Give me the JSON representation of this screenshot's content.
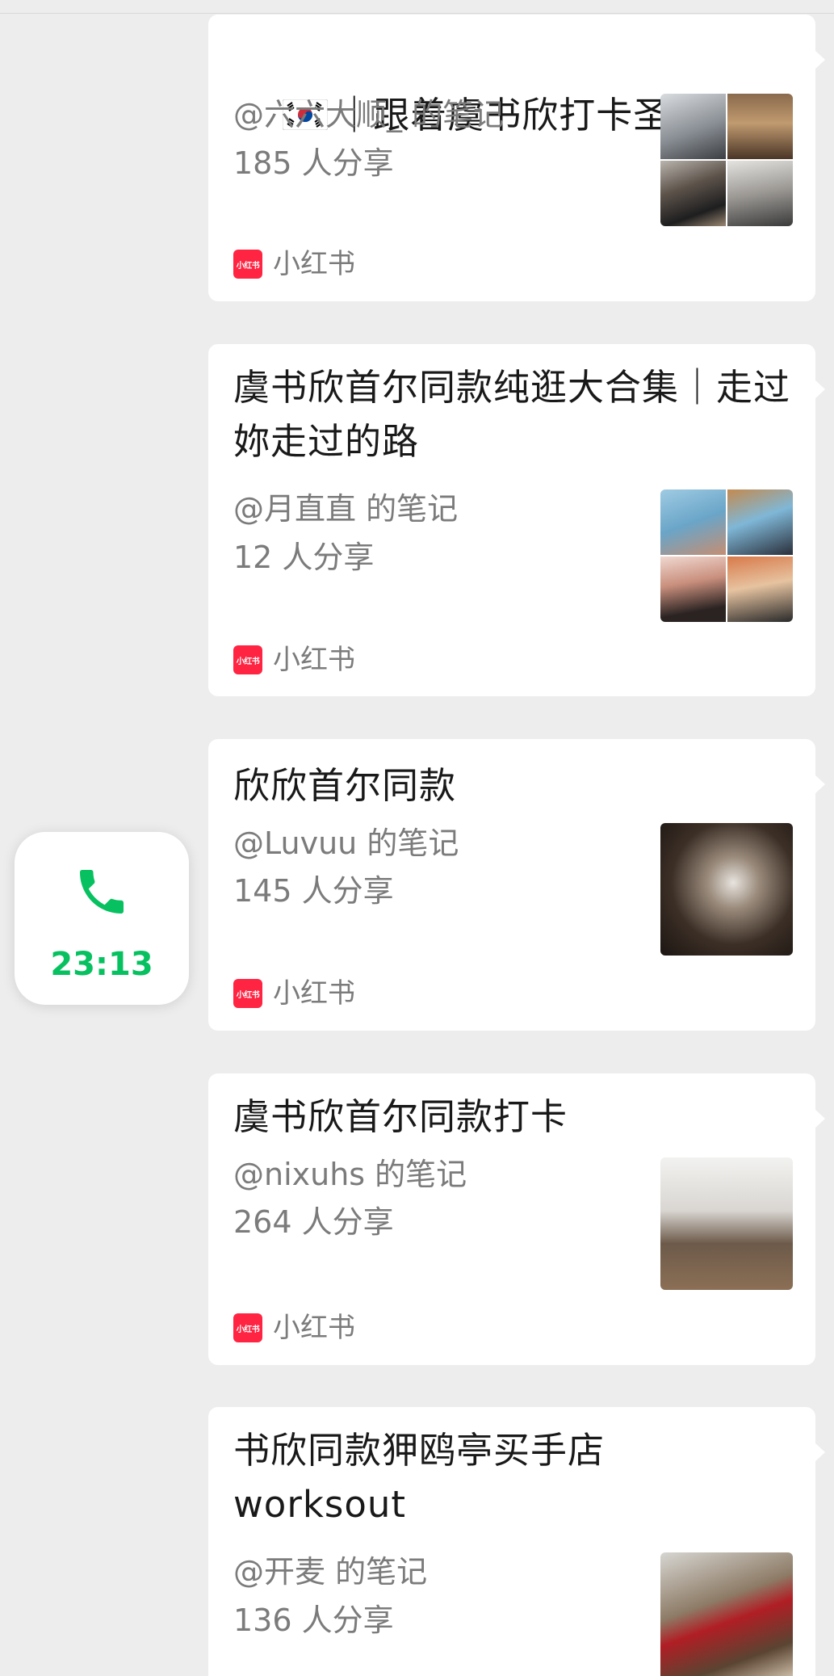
{
  "call": {
    "time": "23:13",
    "color": "#07c160",
    "icon": "phone-icon"
  },
  "cards": [
    {
      "title": "｜跟着虞书欣打卡圣水洞",
      "flag": "south-korea-flag-icon",
      "author": "@六六大顺_ 的笔记",
      "shares": "185 人分享",
      "source": "小红书",
      "source_logo_text": "小红书"
    },
    {
      "title": "虞书欣首尔同款纯逛大合集｜走过妳走过的路",
      "author": "@月直直 的笔记",
      "shares": "12 人分享",
      "source": "小红书",
      "source_logo_text": "小红书"
    },
    {
      "title": "欣欣首尔同款",
      "author": "@Luvuu 的笔记",
      "shares": "145 人分享",
      "source": "小红书",
      "source_logo_text": "小红书"
    },
    {
      "title": "虞书欣首尔同款打卡",
      "author": "@nixuhs 的笔记",
      "shares": "264 人分享",
      "source": "小红书",
      "source_logo_text": "小红书"
    },
    {
      "title": "书欣同款狎鸥亭买手店 worksout",
      "author": "@开麦 的笔记",
      "shares": "136 人分享"
    }
  ],
  "colors": {
    "background": "#ededed",
    "card": "#ffffff",
    "source_brand": "#ff2442",
    "secondary_text": "#7b7b7b"
  }
}
